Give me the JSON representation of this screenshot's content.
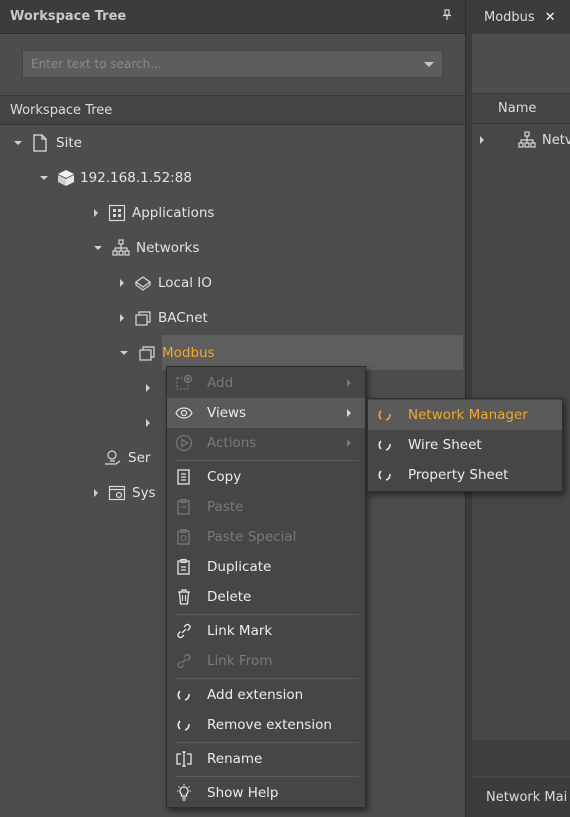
{
  "left_panel": {
    "title": "Workspace Tree",
    "pin_icon": "pin-icon",
    "search": {
      "placeholder": "Enter text to search...",
      "value": ""
    },
    "tree_header": "Workspace Tree",
    "tree": [
      {
        "label": "Site",
        "icon": "page-icon",
        "expanded": true
      },
      {
        "label": "192.168.1.52:88",
        "icon": "cube-icon",
        "expanded": true
      },
      {
        "label": "Applications",
        "icon": "applications-icon",
        "expanded": false
      },
      {
        "label": "Networks",
        "icon": "network-icon",
        "expanded": true
      },
      {
        "label": "Local IO",
        "icon": "local-io-icon",
        "expanded": false
      },
      {
        "label": "BACnet",
        "icon": "device-stack-icon",
        "expanded": false
      },
      {
        "label": "Modbus",
        "icon": "device-stack-icon",
        "expanded": true,
        "selected": true
      },
      {
        "label": "Ser",
        "icon": "services-icon",
        "expanded": false
      },
      {
        "label": "Sys",
        "icon": "system-icon",
        "expanded": false
      }
    ]
  },
  "right_panel": {
    "tab_label": "Modbus",
    "close_label": "✕",
    "column_header": "Name",
    "row_label": "Netv",
    "bottom_tab": "Network Mai"
  },
  "context_menu": {
    "items": [
      {
        "label": "Add",
        "icon": "add-icon",
        "disabled": true,
        "submenu": true
      },
      {
        "label": "Views",
        "icon": "eye-icon",
        "disabled": false,
        "submenu": true,
        "hover": true
      },
      {
        "label": "Actions",
        "icon": "play-icon",
        "disabled": true,
        "submenu": true
      },
      {
        "label": "Copy",
        "icon": "copy-icon",
        "disabled": false
      },
      {
        "label": "Paste",
        "icon": "paste-icon",
        "disabled": true
      },
      {
        "label": "Paste Special",
        "icon": "paste-special-icon",
        "disabled": true
      },
      {
        "label": "Duplicate",
        "icon": "duplicate-icon",
        "disabled": false
      },
      {
        "label": "Delete",
        "icon": "trash-icon",
        "disabled": false
      },
      {
        "label": "Link Mark",
        "icon": "link-icon",
        "disabled": false
      },
      {
        "label": "Link From",
        "icon": "link-icon",
        "disabled": true
      },
      {
        "label": "Add extension",
        "icon": "extension-icon",
        "disabled": false
      },
      {
        "label": "Remove extension",
        "icon": "extension-icon",
        "disabled": false
      },
      {
        "label": "Rename",
        "icon": "rename-icon",
        "disabled": false
      },
      {
        "label": "Show Help",
        "icon": "help-bulb-icon",
        "disabled": false
      }
    ]
  },
  "views_submenu": {
    "items": [
      {
        "label": "Network Manager",
        "icon": "view-icon",
        "hover": true
      },
      {
        "label": "Wire Sheet",
        "icon": "view-icon"
      },
      {
        "label": "Property Sheet",
        "icon": "view-icon"
      }
    ]
  },
  "colors": {
    "accent": "#f0a830",
    "panel": "#4d4d4d",
    "menu": "#464646"
  }
}
